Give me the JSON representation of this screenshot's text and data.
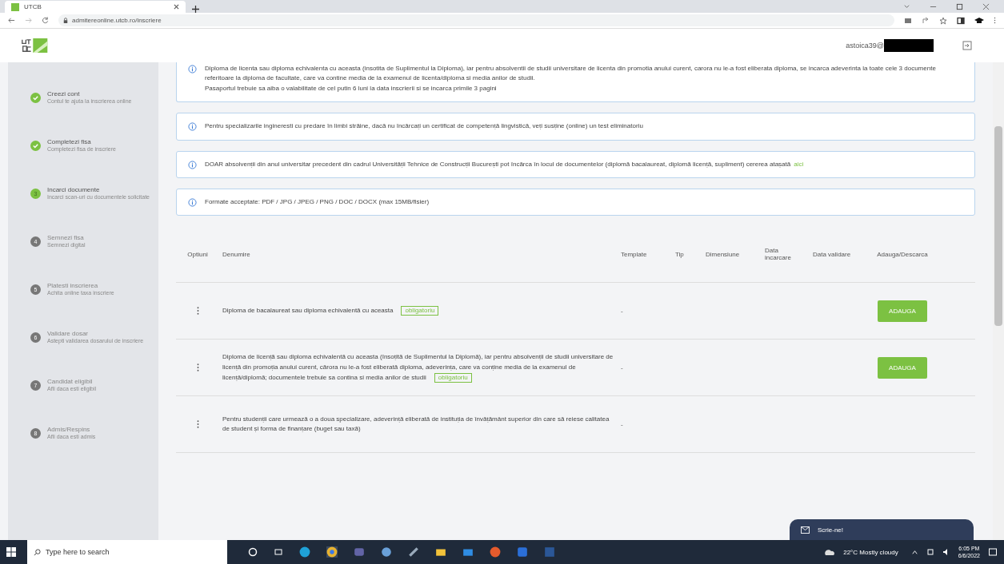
{
  "browser": {
    "tab_title": "UTCB",
    "url": "admitereonline.utcb.ro/inscriere"
  },
  "header": {
    "user_email": "astoica39@"
  },
  "steps": [
    {
      "title": "Creezi cont",
      "subtitle": "Contul te ajuta la inscrierea online",
      "kind": "done"
    },
    {
      "title": "Completezi fisa",
      "subtitle": "Completezi fisa de inscriere",
      "kind": "done"
    },
    {
      "title": "Incarci documente",
      "subtitle": "Incarci scan-uri cu documentele solicitate",
      "kind": "current",
      "number": "3"
    },
    {
      "title": "Semnezi fisa",
      "subtitle": "Semnezi digital",
      "kind": "pending",
      "number": "4"
    },
    {
      "title": "Platesti inscrierea",
      "subtitle": "Achita online taxa inscriere",
      "kind": "pending",
      "number": "5"
    },
    {
      "title": "Validare dosar",
      "subtitle": "Astepti validarea dosarului de inscriere",
      "kind": "pending",
      "number": "6"
    },
    {
      "title": "Candidat eligibil",
      "subtitle": "Afli daca esti eligibil",
      "kind": "pending",
      "number": "7"
    },
    {
      "title": "Admis/Respins",
      "subtitle": "Afli daca esti admis",
      "kind": "pending",
      "number": "8"
    }
  ],
  "notices": [
    {
      "lines": [
        "Diploma de licenta sau diploma echivalenta cu aceasta (insotita de Suplimentul la Diploma), iar pentru absolventii de studii universitare de licenta din promotia anului curent, carora nu le-a fost eliberata diploma, se incarca adeverinta la toate cele 3 documente referitoare la diploma de facultate, care va contine media de la examenul de licenta/diploma si media anilor de studii.",
        "Pasaportul trebuie sa aiba o valabilitate de cel putin 6 luni la data inscrierii si se incarca primile 3 pagini"
      ]
    },
    {
      "lines": [
        "Pentru specializarile ingineresti cu predare în limbi străine, dacă nu încărcați un certificat de competență lingvistică, veți susține (online) un test eliminatoriu"
      ]
    },
    {
      "lines": [
        "DOAR absolvenții din anul universitar precedent din cadrul Universității Tehnice de Construcții București pot încărca în locul de documentelor (diplomă bacalaureat, diplomă licență, supliment) cererea atașată"
      ],
      "link": "aici"
    },
    {
      "lines": [
        "Formate acceptate: PDF / JPG / JPEG / PNG / DOC / DOCX (max 15MB/fisier)"
      ]
    }
  ],
  "table": {
    "columns": [
      "Optiuni",
      "Denumire",
      "Template",
      "Tip",
      "Dimensiune",
      "Data incarcare",
      "Data validare",
      "Adauga/Descarca"
    ],
    "rows": [
      {
        "name": "Diploma de bacalaureat sau diploma echivalentă cu aceasta",
        "tag": "obligatoriu",
        "template": "-",
        "action": "ADAUGA"
      },
      {
        "name": "Diploma de licență sau diploma echivalentă cu aceasta (însoțită de Suplimentul la Diplomă), iar pentru absolvenții de studii universitare de licență din promoția anului curent, cărora nu le-a fost eliberată diploma, adeverința, care va conține media de la examenul de licență/diplomă; documentele trebuie sa contina si media anilor de studii",
        "tag": "obligatoriu",
        "template": "-",
        "action": "ADAUGA"
      },
      {
        "name": "Pentru studenții care urmează o a doua specializare, adeverință eliberată de instituția de învățământ superior din care să reiese calitatea de student și forma de finanțare (buget sau taxă)",
        "template": "-"
      }
    ]
  },
  "chat": {
    "label": "Scrie-ne!"
  },
  "taskbar": {
    "search_placeholder": "Type here to search",
    "weather": "22°C  Mostly cloudy",
    "time": "6:05 PM",
    "date": "6/6/2022"
  }
}
